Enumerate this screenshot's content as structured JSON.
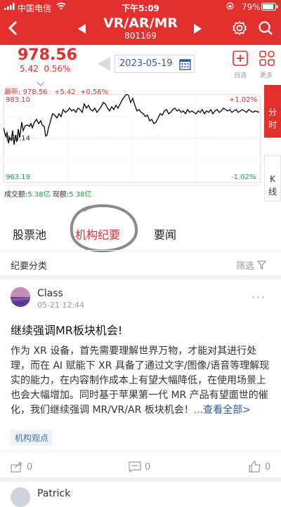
{
  "status_bar": {
    "carrier": "中国电信",
    "time": "下午5:09",
    "battery": "79%"
  },
  "header": {
    "title": "VR/AR/MR",
    "code": "801169"
  },
  "quote": {
    "price": "978.56",
    "change": "5.42",
    "change_pct": "0.56%",
    "date": "2023-05-19",
    "add_label": "自选",
    "more_label": "更多"
  },
  "chart": {
    "latest_label": "最新:",
    "latest_value": "978.56",
    "latest_change": "+5.42",
    "latest_pct": "+0.56%",
    "y_high": "983.10",
    "y_mid": "973.14",
    "y_low": "963.19",
    "pct_high": "+1.02%",
    "pct_low": "-1.02%",
    "volume_label": "成交额:",
    "volume_value": "5.38亿",
    "cash_label": "现额:",
    "cash_value": "5.38亿",
    "tab_intraday": [
      "分",
      "时"
    ],
    "tab_kline": [
      "K",
      "线"
    ]
  },
  "tabs": [
    "股票池",
    "机构纪要",
    "要闻"
  ],
  "filter_bar": {
    "title": "纪要分类",
    "filter_label": "筛选"
  },
  "post": {
    "author": "Class",
    "time": "05-21 12:44",
    "title": "继续强调MR板块机会!",
    "body": "作为 XR 设备，首先需要理解世界万物，才能对其进行处理，而在 AI 赋能下 XR 具备了通过文字/图像/语音等理解现实的能力，在内容制作成本上有望大幅降低，在使用场景上也会大幅增加。同时基于苹果第一代 MR 产品有望面世的催化，我们继续强调 MR/VR/AR 板块机会！",
    "see_all": "...查看全部>",
    "tag": "机构观点",
    "share_count": "0",
    "comment_count": "0",
    "like_count": "0"
  },
  "next_post": {
    "author": "Patrick"
  },
  "colors": {
    "brand_red": "#e3302e",
    "link_blue": "#2e5d9c",
    "up_green": "#1aa049"
  }
}
